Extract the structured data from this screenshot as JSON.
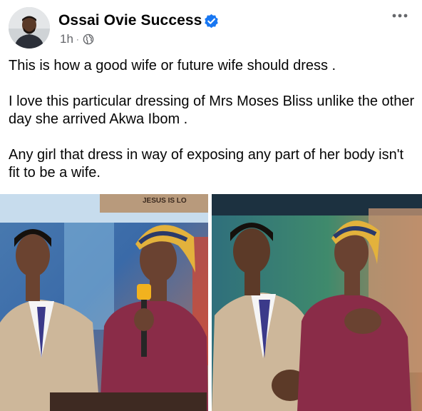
{
  "post": {
    "author": {
      "name": "Ossai Ovie Success",
      "verified": true,
      "avatar": "avatar-photo"
    },
    "timestamp": "1h",
    "separator": "·",
    "audience_icon": "globe-icon",
    "menu_icon": "more-horizontal-icon",
    "caption": [
      "This is how a good wife or future wife should dress .",
      "I love this particular dressing of Mrs Moses Bliss unlike the other day she arrived Akwa Ibom .",
      "Any girl that dress in way of exposing any part of her body isn't fit to be a wife."
    ],
    "photos": [
      {
        "name": "couple-on-stage-photo-left",
        "banner_text": "JESUS IS LO"
      },
      {
        "name": "couple-on-stage-photo-right"
      }
    ],
    "colors": {
      "verified_blue": "#1877f2",
      "secondary_text": "#65676b",
      "dress_maroon": "#8a2c48",
      "suit_beige": "#cdb79a"
    }
  }
}
